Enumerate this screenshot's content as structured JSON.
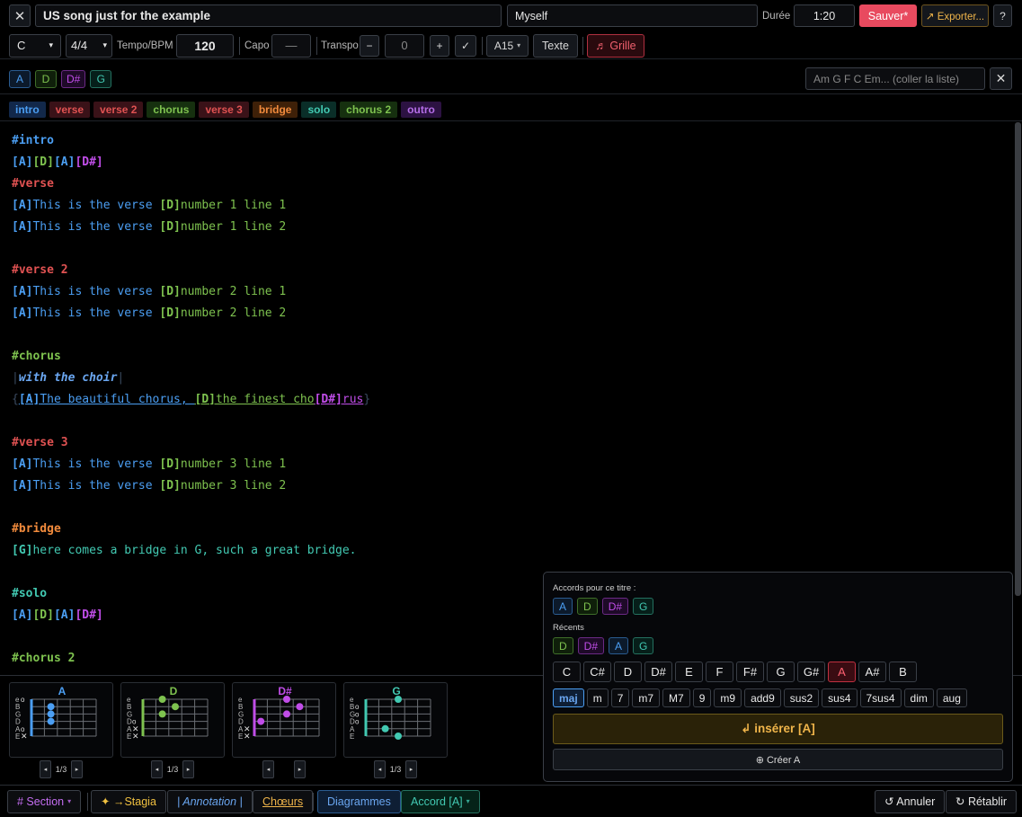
{
  "header": {
    "close_icon": "close-icon",
    "title": "US song just for the example",
    "artist": "Myself",
    "duration_label": "Durée",
    "duration": "1:20",
    "save_label": "Sauver*",
    "export_label": "↗ Exporter...",
    "help_label": "?"
  },
  "toolbar": {
    "key": "C",
    "time_signature": "4/4",
    "tempo_label": "Tempo/BPM",
    "tempo": "120",
    "capo_label": "Capo",
    "capo_value": "—",
    "transpo_label": "Transpo",
    "minus_label": "−",
    "transpo_value": "0",
    "plus_label": "+",
    "check_label": "✓",
    "format": "A15",
    "text_label": "Texte",
    "grid_label": "♬ Grille"
  },
  "chords_bar": {
    "chords": [
      "A",
      "D",
      "D#",
      "G"
    ],
    "paste_placeholder": "Am G F C Em... (coller la liste)",
    "clear_icon": "close-icon"
  },
  "sections": [
    {
      "label": "intro",
      "color": "#4b9ef2",
      "bg": "#12284a"
    },
    {
      "label": "verse",
      "color": "#e05252",
      "bg": "#3a1218"
    },
    {
      "label": "verse 2",
      "color": "#e05252",
      "bg": "#3a1218"
    },
    {
      "label": "chorus",
      "color": "#7ec24f",
      "bg": "#16300f"
    },
    {
      "label": "verse 3",
      "color": "#e05252",
      "bg": "#3a1218"
    },
    {
      "label": "bridge",
      "color": "#f08a3c",
      "bg": "#3e2008"
    },
    {
      "label": "solo",
      "color": "#42c9b2",
      "bg": "#0a2e28"
    },
    {
      "label": "chorus 2",
      "color": "#7ec24f",
      "bg": "#16300f"
    },
    {
      "label": "outro",
      "color": "#b56ee8",
      "bg": "#2c1242"
    }
  ],
  "editor_lines": [
    [
      {
        "t": "#intro",
        "c": "sec-intro"
      }
    ],
    [
      {
        "t": "[A]",
        "c": "ch-A"
      },
      {
        "t": "[D]",
        "c": "ch-D"
      },
      {
        "t": "[A]",
        "c": "ch-A"
      },
      {
        "t": "[D#]",
        "c": "ch-Ds"
      }
    ],
    [
      {
        "t": "#verse",
        "c": "sec-verse"
      }
    ],
    [
      {
        "t": "[A]",
        "c": "ch-A"
      },
      {
        "t": "This is the verse ",
        "c": "ly-A"
      },
      {
        "t": "[D]",
        "c": "ch-D"
      },
      {
        "t": "number 1 line 1",
        "c": "ly-D"
      }
    ],
    [
      {
        "t": "[A]",
        "c": "ch-A"
      },
      {
        "t": "This is the verse ",
        "c": "ly-A"
      },
      {
        "t": "[D]",
        "c": "ch-D"
      },
      {
        "t": "number 1 line 2",
        "c": "ly-D"
      }
    ],
    [],
    [
      {
        "t": "#verse 2",
        "c": "sec-verse"
      }
    ],
    [
      {
        "t": "[A]",
        "c": "ch-A"
      },
      {
        "t": "This is the verse ",
        "c": "ly-A"
      },
      {
        "t": "[D]",
        "c": "ch-D"
      },
      {
        "t": "number 2 line 1",
        "c": "ly-D"
      }
    ],
    [
      {
        "t": "[A]",
        "c": "ch-A"
      },
      {
        "t": "This is the verse ",
        "c": "ly-A"
      },
      {
        "t": "[D]",
        "c": "ch-D"
      },
      {
        "t": "number 2 line 2",
        "c": "ly-D"
      }
    ],
    [],
    [
      {
        "t": "#chorus",
        "c": "sec-chorus"
      }
    ],
    [
      {
        "t": "|",
        "c": "bar"
      },
      {
        "t": "with the choir",
        "c": "annot"
      },
      {
        "t": "|",
        "c": "bar"
      }
    ],
    [
      {
        "t": "{",
        "c": "bar"
      },
      {
        "t": "[A]",
        "c": "ch-A u"
      },
      {
        "t": "The beautiful chorus, ",
        "c": "ly-A u"
      },
      {
        "t": "[D]",
        "c": "ch-D u"
      },
      {
        "t": "the finest cho",
        "c": "ly-D u"
      },
      {
        "t": "[D#]",
        "c": "ch-Ds u"
      },
      {
        "t": "rus",
        "c": "ly-Ds u"
      },
      {
        "t": "}",
        "c": "bar"
      }
    ],
    [],
    [
      {
        "t": "#verse 3",
        "c": "sec-verse"
      }
    ],
    [
      {
        "t": "[A]",
        "c": "ch-A"
      },
      {
        "t": "This is the verse ",
        "c": "ly-A"
      },
      {
        "t": "[D]",
        "c": "ch-D"
      },
      {
        "t": "number 3 line 1",
        "c": "ly-D"
      }
    ],
    [
      {
        "t": "[A]",
        "c": "ch-A"
      },
      {
        "t": "This is the verse ",
        "c": "ly-A"
      },
      {
        "t": "[D]",
        "c": "ch-D"
      },
      {
        "t": "number 3 line 2",
        "c": "ly-D"
      }
    ],
    [],
    [
      {
        "t": "#bridge",
        "c": "sec-bridge"
      }
    ],
    [
      {
        "t": "[G]",
        "c": "ch-G"
      },
      {
        "t": "here comes a bridge in G, such a great bridge.",
        "c": "ly-G"
      }
    ],
    [],
    [
      {
        "t": "#solo",
        "c": "sec-solo"
      }
    ],
    [
      {
        "t": "[A]",
        "c": "ch-A"
      },
      {
        "t": "[D]",
        "c": "ch-D"
      },
      {
        "t": "[A]",
        "c": "ch-A"
      },
      {
        "t": "[D#]",
        "c": "ch-Ds"
      }
    ],
    [],
    [
      {
        "t": "#chorus 2",
        "c": "sec-chorus"
      }
    ]
  ],
  "diagrams": [
    {
      "name": "A",
      "color": "#4b9ef2",
      "strings": [
        "e",
        "B",
        "G",
        "D",
        "A",
        "E"
      ],
      "markers": [
        "o",
        "",
        "",
        "",
        "o",
        "x"
      ],
      "dots": [
        [
          1,
          2
        ],
        [
          2,
          2
        ],
        [
          3,
          2
        ]
      ],
      "page": "1/3"
    },
    {
      "name": "D",
      "color": "#7ec24f",
      "strings": [
        "e",
        "B",
        "G",
        "D",
        "A",
        "E"
      ],
      "markers": [
        "",
        "",
        "",
        "o",
        "x",
        "x"
      ],
      "dots": [
        [
          0,
          2
        ],
        [
          1,
          3
        ],
        [
          2,
          2
        ]
      ],
      "page": "1/3"
    },
    {
      "name": "D#",
      "color": "#c04de8",
      "strings": [
        "e",
        "B",
        "G",
        "D",
        "A",
        "E"
      ],
      "markers": [
        "",
        "",
        "",
        "",
        "x",
        "x"
      ],
      "dots": [
        [
          0,
          3
        ],
        [
          1,
          4
        ],
        [
          2,
          3
        ],
        [
          3,
          1
        ]
      ],
      "page": ""
    },
    {
      "name": "G",
      "color": "#42c9b2",
      "strings": [
        "e",
        "B",
        "G",
        "D",
        "A",
        "E"
      ],
      "markers": [
        "",
        "o",
        "o",
        "o",
        "",
        ""
      ],
      "dots": [
        [
          0,
          3
        ],
        [
          4,
          2
        ],
        [
          5,
          3
        ]
      ],
      "page": "1/3"
    }
  ],
  "picker": {
    "title_chords_label": "Accords pour ce titre :",
    "title_chords": [
      "A",
      "D",
      "D#",
      "G"
    ],
    "recent_label": "Récents",
    "recent_chords": [
      "D",
      "D#",
      "A",
      "G"
    ],
    "roots": [
      "C",
      "C#",
      "D",
      "D#",
      "E",
      "F",
      "F#",
      "G",
      "G#",
      "A",
      "A#",
      "B"
    ],
    "selected_root": "A",
    "qualities": [
      "maj",
      "m",
      "7",
      "m7",
      "M7",
      "9",
      "m9",
      "add9",
      "sus2",
      "sus4",
      "7sus4",
      "dim",
      "aug"
    ],
    "selected_quality": "maj",
    "insert_label": "↲ insérer [A]",
    "create_label": "⊕ Créer A"
  },
  "bottombar": {
    "section_label": "# Section",
    "stagia_label": "✦ →Stagia",
    "annotation_label": "| Annotation |",
    "choeurs_label": "Chœurs",
    "diagrammes_label": "Diagrammes",
    "accord_label": "Accord [A]",
    "undo_label": "↺ Annuler",
    "redo_label": "↻ Rétablir"
  }
}
